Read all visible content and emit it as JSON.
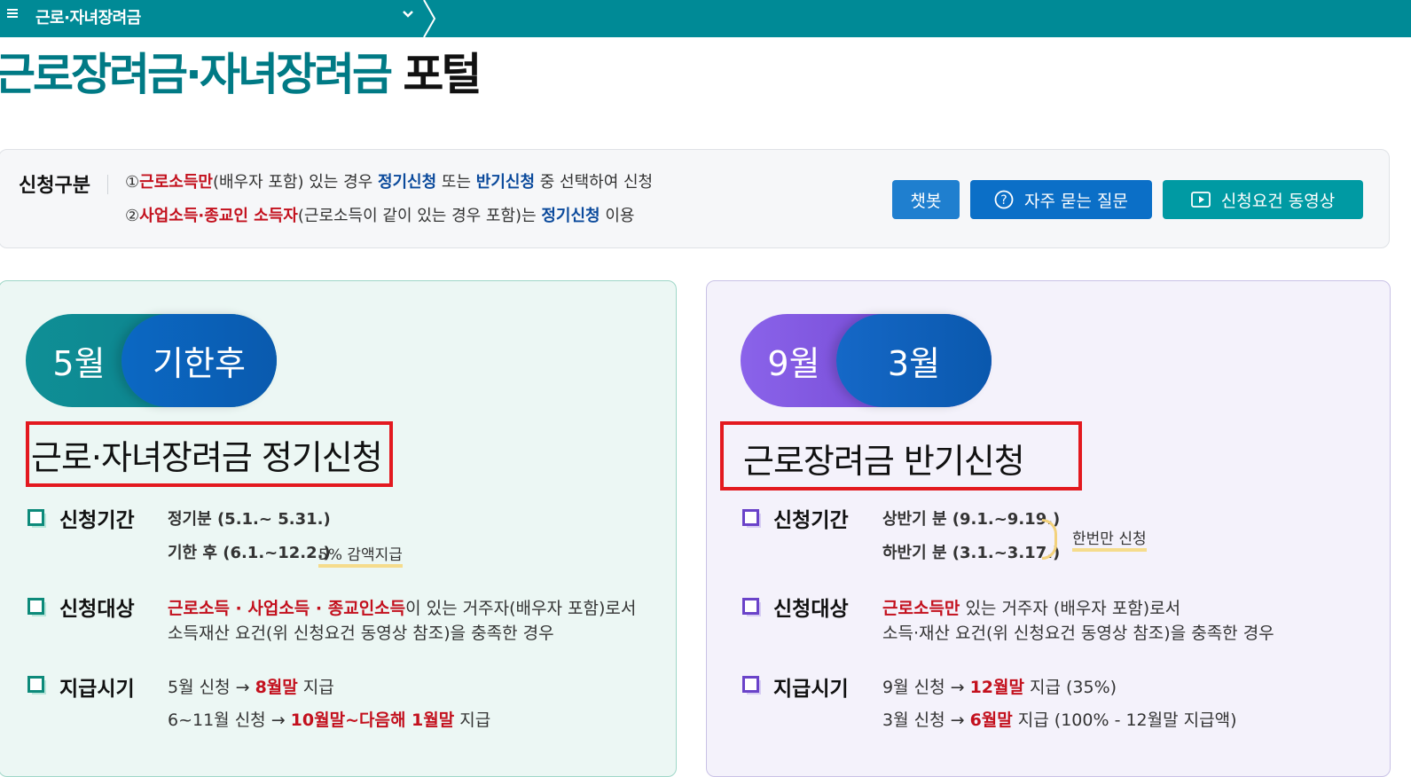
{
  "topbar": {
    "breadcrumb": "근로·자녀장려금"
  },
  "page_title": {
    "main": "근로장려금·자녀장려금",
    "suffix": "포털"
  },
  "apply_type": {
    "label": "신청구분",
    "line1": {
      "num": "①",
      "red": "근로소득만",
      "text1": "(배우자 포함) 있는 경우 ",
      "blue1": "정기신청",
      "text2": " 또는 ",
      "blue2": "반기신청",
      "text3": " 중 선택하여 신청"
    },
    "line2": {
      "num": "②",
      "red": "사업소득·종교인 소득자",
      "text1": "(근로소득이 같이 있는 경우 포함)는 ",
      "blue1": "정기신청",
      "text2": " 이용"
    }
  },
  "buttons": {
    "chatbot": "챗봇",
    "faq": "자주 묻는 질문",
    "video": "신청요건 동영상"
  },
  "regular": {
    "pill_a": "5월",
    "pill_b": "기한후",
    "title": "근로·자녀장려금 정기신청",
    "period_label": "신청기간",
    "period1": "정기분 (5.1.~ 5.31.)",
    "period2": "기한 후 (6.1.~12.2.)",
    "period2_tag": "5% 감액지급",
    "target_label": "신청대상",
    "target_red": "근로소득 · 사업소득 · 종교인소득",
    "target_text1": "이 있는 거주자(배우자 포함)로서",
    "target_text2": "소득재산 요건(위 신청요건 동영상 참조)을 충족한 경우",
    "pay_label": "지급시기",
    "pay1_a": "5월 신청 → ",
    "pay1_red": "8월말",
    "pay1_b": " 지급",
    "pay2_a": "6~11월 신청 → ",
    "pay2_red": "10월말~다음해 1월말",
    "pay2_b": " 지급"
  },
  "half": {
    "pill_a": "9월",
    "pill_b": "3월",
    "title": "근로장려금 반기신청",
    "period_label": "신청기간",
    "period1": "상반기 분 (9.1.~9.19.)",
    "period2": "하반기 분 (3.1.~3.17.)",
    "period_tag": "한번만 신청",
    "target_label": "신청대상",
    "target_red": "근로소득만",
    "target_text1": " 있는 거주자 (배우자 포함)로서",
    "target_text2": "소득·재산 요건(위 신청요건 동영상 참조)을 충족한 경우",
    "pay_label": "지급시기",
    "pay1_a": "9월 신청 → ",
    "pay1_red": "12월말",
    "pay1_b": " 지급 (35%)",
    "pay2_a": "3월 신청 → ",
    "pay2_red": "6월말",
    "pay2_b": " 지급 (100% - 12월말 지급액)"
  }
}
